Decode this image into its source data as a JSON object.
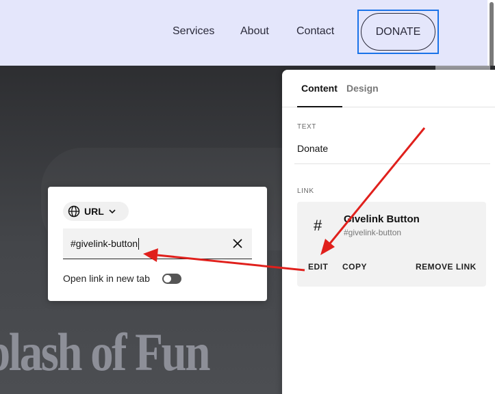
{
  "header": {
    "nav": [
      "Services",
      "About",
      "Contact"
    ],
    "donate_label": "DONATE"
  },
  "hero": {
    "title": "plash of Fun"
  },
  "link_popup": {
    "type_label": "URL",
    "url_value": "#givelink-button",
    "new_tab_label": "Open link in new tab",
    "new_tab_enabled": false
  },
  "panel": {
    "tabs": [
      "Content",
      "Design"
    ],
    "active_tab": "Content",
    "text_section_label": "TEXT",
    "text_value": "Donate",
    "link_section_label": "LINK",
    "link_title": "Givelink Button",
    "link_subtitle": "#givelink-button",
    "actions": [
      "EDIT",
      "COPY",
      "REMOVE LINK"
    ]
  },
  "colors": {
    "annotation_arrow": "#e0201c",
    "focus_ring": "#1a73e8",
    "header_bg": "#e4e6fb"
  }
}
